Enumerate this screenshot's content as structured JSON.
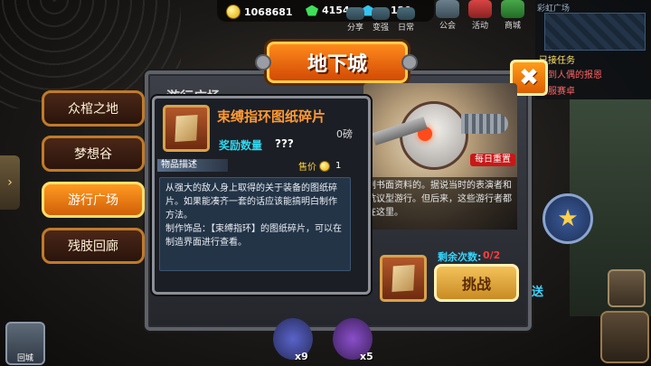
{
  "currencies": {
    "gold": "1068681",
    "green_gems": "4154",
    "blue_gems": "120"
  },
  "top_menu": [
    {
      "label": "分享",
      "icon": "share-icon"
    },
    {
      "label": "变强",
      "icon": "strengthen-icon"
    },
    {
      "label": "日常",
      "icon": "daily-icon"
    },
    {
      "label": "公会",
      "icon": "guild-icon"
    },
    {
      "label": "活动",
      "icon": "event-icon"
    },
    {
      "label": "商城",
      "icon": "shop-icon"
    }
  ],
  "quest_panel": {
    "title": "彩虹广场",
    "line1": "已接任务",
    "line2": "找到人偶的报恩",
    "line3": "归服赛卓"
  },
  "dialog": {
    "title": "地下城",
    "close_label": "✖"
  },
  "nav": [
    {
      "label": "众棺之地",
      "active": false
    },
    {
      "label": "梦想谷",
      "active": false
    },
    {
      "label": "游行广场",
      "active": true
    },
    {
      "label": "残肢回廊",
      "active": false
    }
  ],
  "dungeon": {
    "area_label": "游行广场",
    "daily_badge": "每日重置",
    "description": "剧书面资料的。据说当时的表演者和抗议型游行。但后来，这些游行者都在这里。",
    "remaining_label": "剩余次数:",
    "remaining_value": "0/2",
    "challenge_label": "挑战",
    "cut_label": "送"
  },
  "tooltip": {
    "item_name": "束缚指环图纸碎片",
    "weight": "0磅",
    "reward_label": "奖励数量",
    "reward_value": "???",
    "desc_tag": "物品描述",
    "price_label": "售价",
    "price_value": "1",
    "description": "从强大的敌人身上取得的关于装备的图纸碎片。如果能凑齐一套的话应该能搞明白制作方法。",
    "description2": "制作饰品：【束缚指环】的图纸碎片，可以在制造界面进行查看。"
  },
  "bottom": {
    "back_label": "回城",
    "count1": "x9",
    "count2": "x5"
  }
}
